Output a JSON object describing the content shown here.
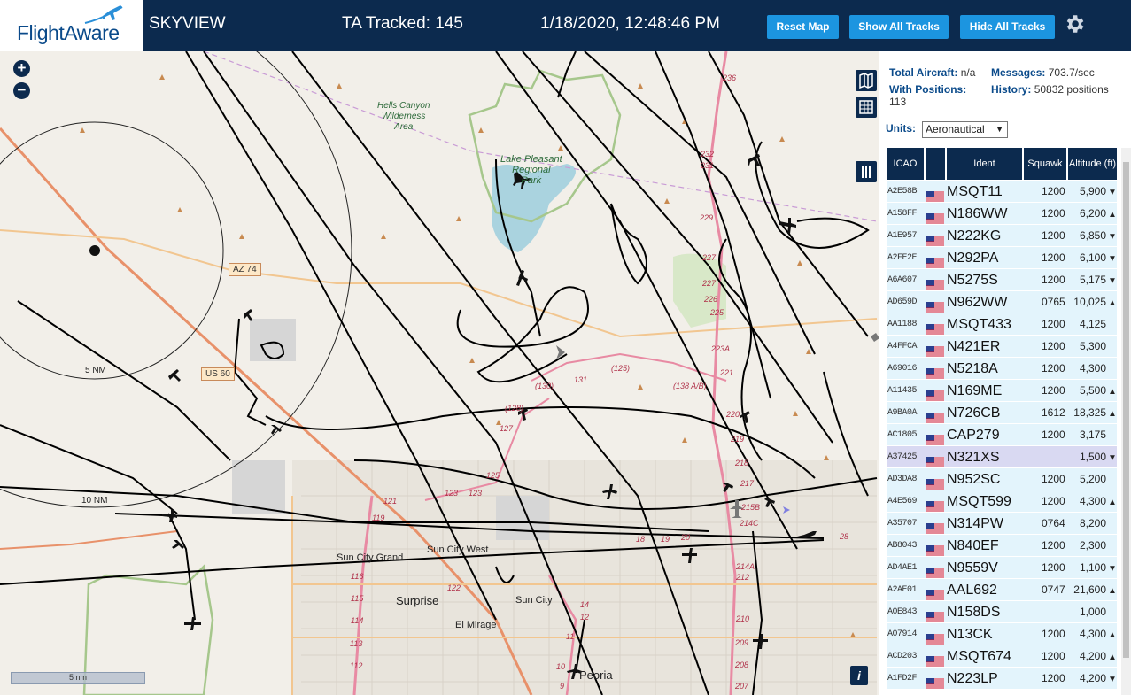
{
  "header": {
    "logo_text": "FlightAware",
    "app_title": "SKYVIEW",
    "tracked": "TA Tracked: 145",
    "datetime": "1/18/2020, 12:48:46 PM",
    "buttons": {
      "reset": "Reset Map",
      "show": "Show All Tracks",
      "hide": "Hide All Tracks"
    }
  },
  "map": {
    "zoom_in": "+",
    "zoom_out": "−",
    "scale_label": "5 nm",
    "info": "i",
    "range_labels": {
      "r5": "5 NM",
      "r10": "10 NM"
    },
    "parks": {
      "hells": "Hells Canyon\nWilderness\nArea",
      "lake": "Lake Pleasant\nRegional\nPark"
    },
    "roads": {
      "az74": "AZ 74",
      "us60": "US 60"
    },
    "cities": {
      "surprise": "Surprise",
      "suncity": "Sun City",
      "suncitywest": "Sun City West",
      "suncitygrand": "Sun City Grand",
      "elmirage": "El Mirage",
      "peoria": "Peoria"
    },
    "exits": [
      "236",
      "232",
      "231",
      "229",
      "227",
      "227",
      "226",
      "225",
      "223A",
      "221",
      "220",
      "219",
      "218",
      "217",
      "215B",
      "214C",
      "214A",
      "212",
      "210",
      "209",
      "208",
      "207",
      "(138 A/B)",
      "(130)",
      "(128)",
      "(125)",
      "131",
      "127",
      "125",
      "123",
      "123",
      "121",
      "18",
      "19",
      "20",
      "28",
      "119",
      "116",
      "115",
      "114",
      "113",
      "112",
      "11",
      "10",
      "9",
      "14",
      "12",
      "122"
    ]
  },
  "panel": {
    "total_aircraft_label": "Total Aircraft:",
    "total_aircraft_value": "n/a",
    "messages_label": "Messages:",
    "messages_value": "703.7/sec",
    "with_positions_label": "With Positions:",
    "with_positions_value": "113",
    "history_label": "History:",
    "history_value": "50832 positions",
    "units_label": "Units:",
    "units_value": "Aeronautical",
    "columns": {
      "icao": "ICAO",
      "ident": "Ident",
      "squawk": "Squawk",
      "altitude": "Altitude (ft)"
    },
    "rows": [
      {
        "icao": "A2E58B",
        "ident": "MSQT11",
        "squawk": "1200",
        "alt": "5,900",
        "trend": "▼"
      },
      {
        "icao": "A158FF",
        "ident": "N186WW",
        "squawk": "1200",
        "alt": "6,200",
        "trend": "▲"
      },
      {
        "icao": "A1E957",
        "ident": "N222KG",
        "squawk": "1200",
        "alt": "6,850",
        "trend": "▼"
      },
      {
        "icao": "A2FE2E",
        "ident": "N292PA",
        "squawk": "1200",
        "alt": "6,100",
        "trend": "▼"
      },
      {
        "icao": "A6A607",
        "ident": "N5275S",
        "squawk": "1200",
        "alt": "5,175",
        "trend": "▼"
      },
      {
        "icao": "AD659D",
        "ident": "N962WW",
        "squawk": "0765",
        "alt": "10,025",
        "trend": "▲"
      },
      {
        "icao": "AA1188",
        "ident": "MSQT433",
        "squawk": "1200",
        "alt": "4,125",
        "trend": ""
      },
      {
        "icao": "A4FFCA",
        "ident": "N421ER",
        "squawk": "1200",
        "alt": "5,300",
        "trend": ""
      },
      {
        "icao": "A69016",
        "ident": "N5218A",
        "squawk": "1200",
        "alt": "4,300",
        "trend": ""
      },
      {
        "icao": "A11435",
        "ident": "N169ME",
        "squawk": "1200",
        "alt": "5,500",
        "trend": "▲"
      },
      {
        "icao": "A9BA0A",
        "ident": "N726CB",
        "squawk": "1612",
        "alt": "18,325",
        "trend": "▲"
      },
      {
        "icao": "AC1805",
        "ident": "CAP279",
        "squawk": "1200",
        "alt": "3,175",
        "trend": ""
      },
      {
        "icao": "A37425",
        "ident": "N321XS",
        "squawk": "",
        "alt": "1,500",
        "trend": "▼"
      },
      {
        "icao": "AD3DA8",
        "ident": "N952SC",
        "squawk": "1200",
        "alt": "5,200",
        "trend": ""
      },
      {
        "icao": "A4E569",
        "ident": "MSQT599",
        "squawk": "1200",
        "alt": "4,300",
        "trend": "▲"
      },
      {
        "icao": "A35707",
        "ident": "N314PW",
        "squawk": "0764",
        "alt": "8,200",
        "trend": ""
      },
      {
        "icao": "AB8043",
        "ident": "N840EF",
        "squawk": "1200",
        "alt": "2,300",
        "trend": ""
      },
      {
        "icao": "AD4AE1",
        "ident": "N9559V",
        "squawk": "1200",
        "alt": "1,100",
        "trend": "▼"
      },
      {
        "icao": "A2AE01",
        "ident": "AAL692",
        "squawk": "0747",
        "alt": "21,600",
        "trend": "▲"
      },
      {
        "icao": "A0E843",
        "ident": "N158DS",
        "squawk": "",
        "alt": "1,000",
        "trend": ""
      },
      {
        "icao": "A07914",
        "ident": "N13CK",
        "squawk": "1200",
        "alt": "4,300",
        "trend": "▲"
      },
      {
        "icao": "ACD203",
        "ident": "MSQT674",
        "squawk": "1200",
        "alt": "4,200",
        "trend": "▲"
      },
      {
        "icao": "A1FD2F",
        "ident": "N223LP",
        "squawk": "1200",
        "alt": "4,200",
        "trend": "▼"
      }
    ],
    "selected_index": 12
  },
  "colors": {
    "nav": "#0c2a4e",
    "button": "#1c95e0",
    "row": "#e3f4fc",
    "row_selected": "#d9d9f2"
  }
}
